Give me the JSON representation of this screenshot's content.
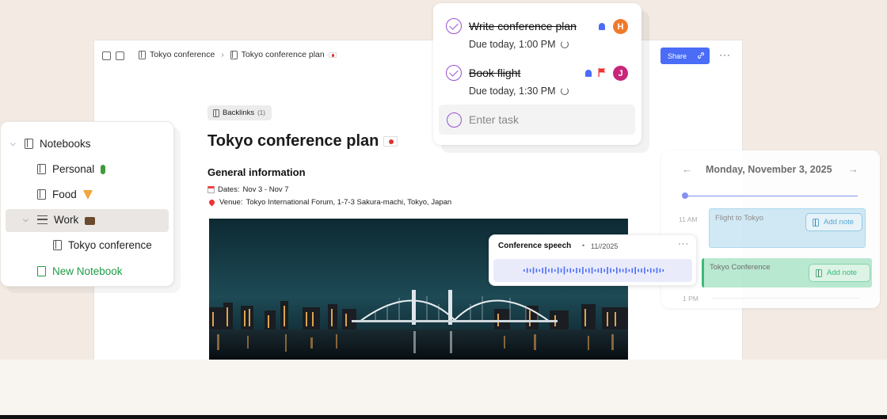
{
  "doc": {
    "breadcrumb": [
      "Tokyo conference",
      "Tokyo conference plan"
    ],
    "share_label": "Share",
    "backlinks_label": "Backlinks",
    "backlinks_count": "(1)",
    "title": "Tokyo conference plan",
    "section_heading": "General information",
    "dates_label": "Dates:",
    "dates_value": "Nov 3 - Nov 7",
    "venue_label": "Venue:",
    "venue_value": "Tokyo International Forum, 1-7-3 Sakura-machi, Tokyo, Japan"
  },
  "sidebar": {
    "root": "Notebooks",
    "items": [
      {
        "label": "Personal",
        "icon": "cactus"
      },
      {
        "label": "Food",
        "icon": "pizza"
      },
      {
        "label": "Work",
        "icon": "briefcase"
      },
      {
        "label": "Tokyo conference",
        "icon": "notebook"
      }
    ],
    "new_notebook": "New Notebook"
  },
  "tasks": {
    "items": [
      {
        "title": "Write conference plan",
        "due": "Due today, 1:00 PM",
        "avatar": "H",
        "avatar_color": "#f07a2a",
        "done": true
      },
      {
        "title": "Book flight",
        "due": "Due today, 1:30 PM",
        "avatar": "J",
        "avatar_color": "#c8267a",
        "done": true
      }
    ],
    "input_placeholder": "Enter task"
  },
  "calendar": {
    "date": "Monday, November 3, 2025",
    "times": [
      "11 AM",
      "1 PM"
    ],
    "events": [
      {
        "title": "Flight to Tokyo",
        "add_note": "Add note",
        "color": "#cfe8f5"
      },
      {
        "title": "Tokyo Conference",
        "add_note": "Add note",
        "color": "#b6e8cf"
      }
    ]
  },
  "speech": {
    "title": "Conference speech",
    "date": "11//2025"
  },
  "colors": {
    "accent": "#4a6cf7",
    "task_purple": "#9b4fd1",
    "new_notebook_green": "#1e9b45"
  }
}
